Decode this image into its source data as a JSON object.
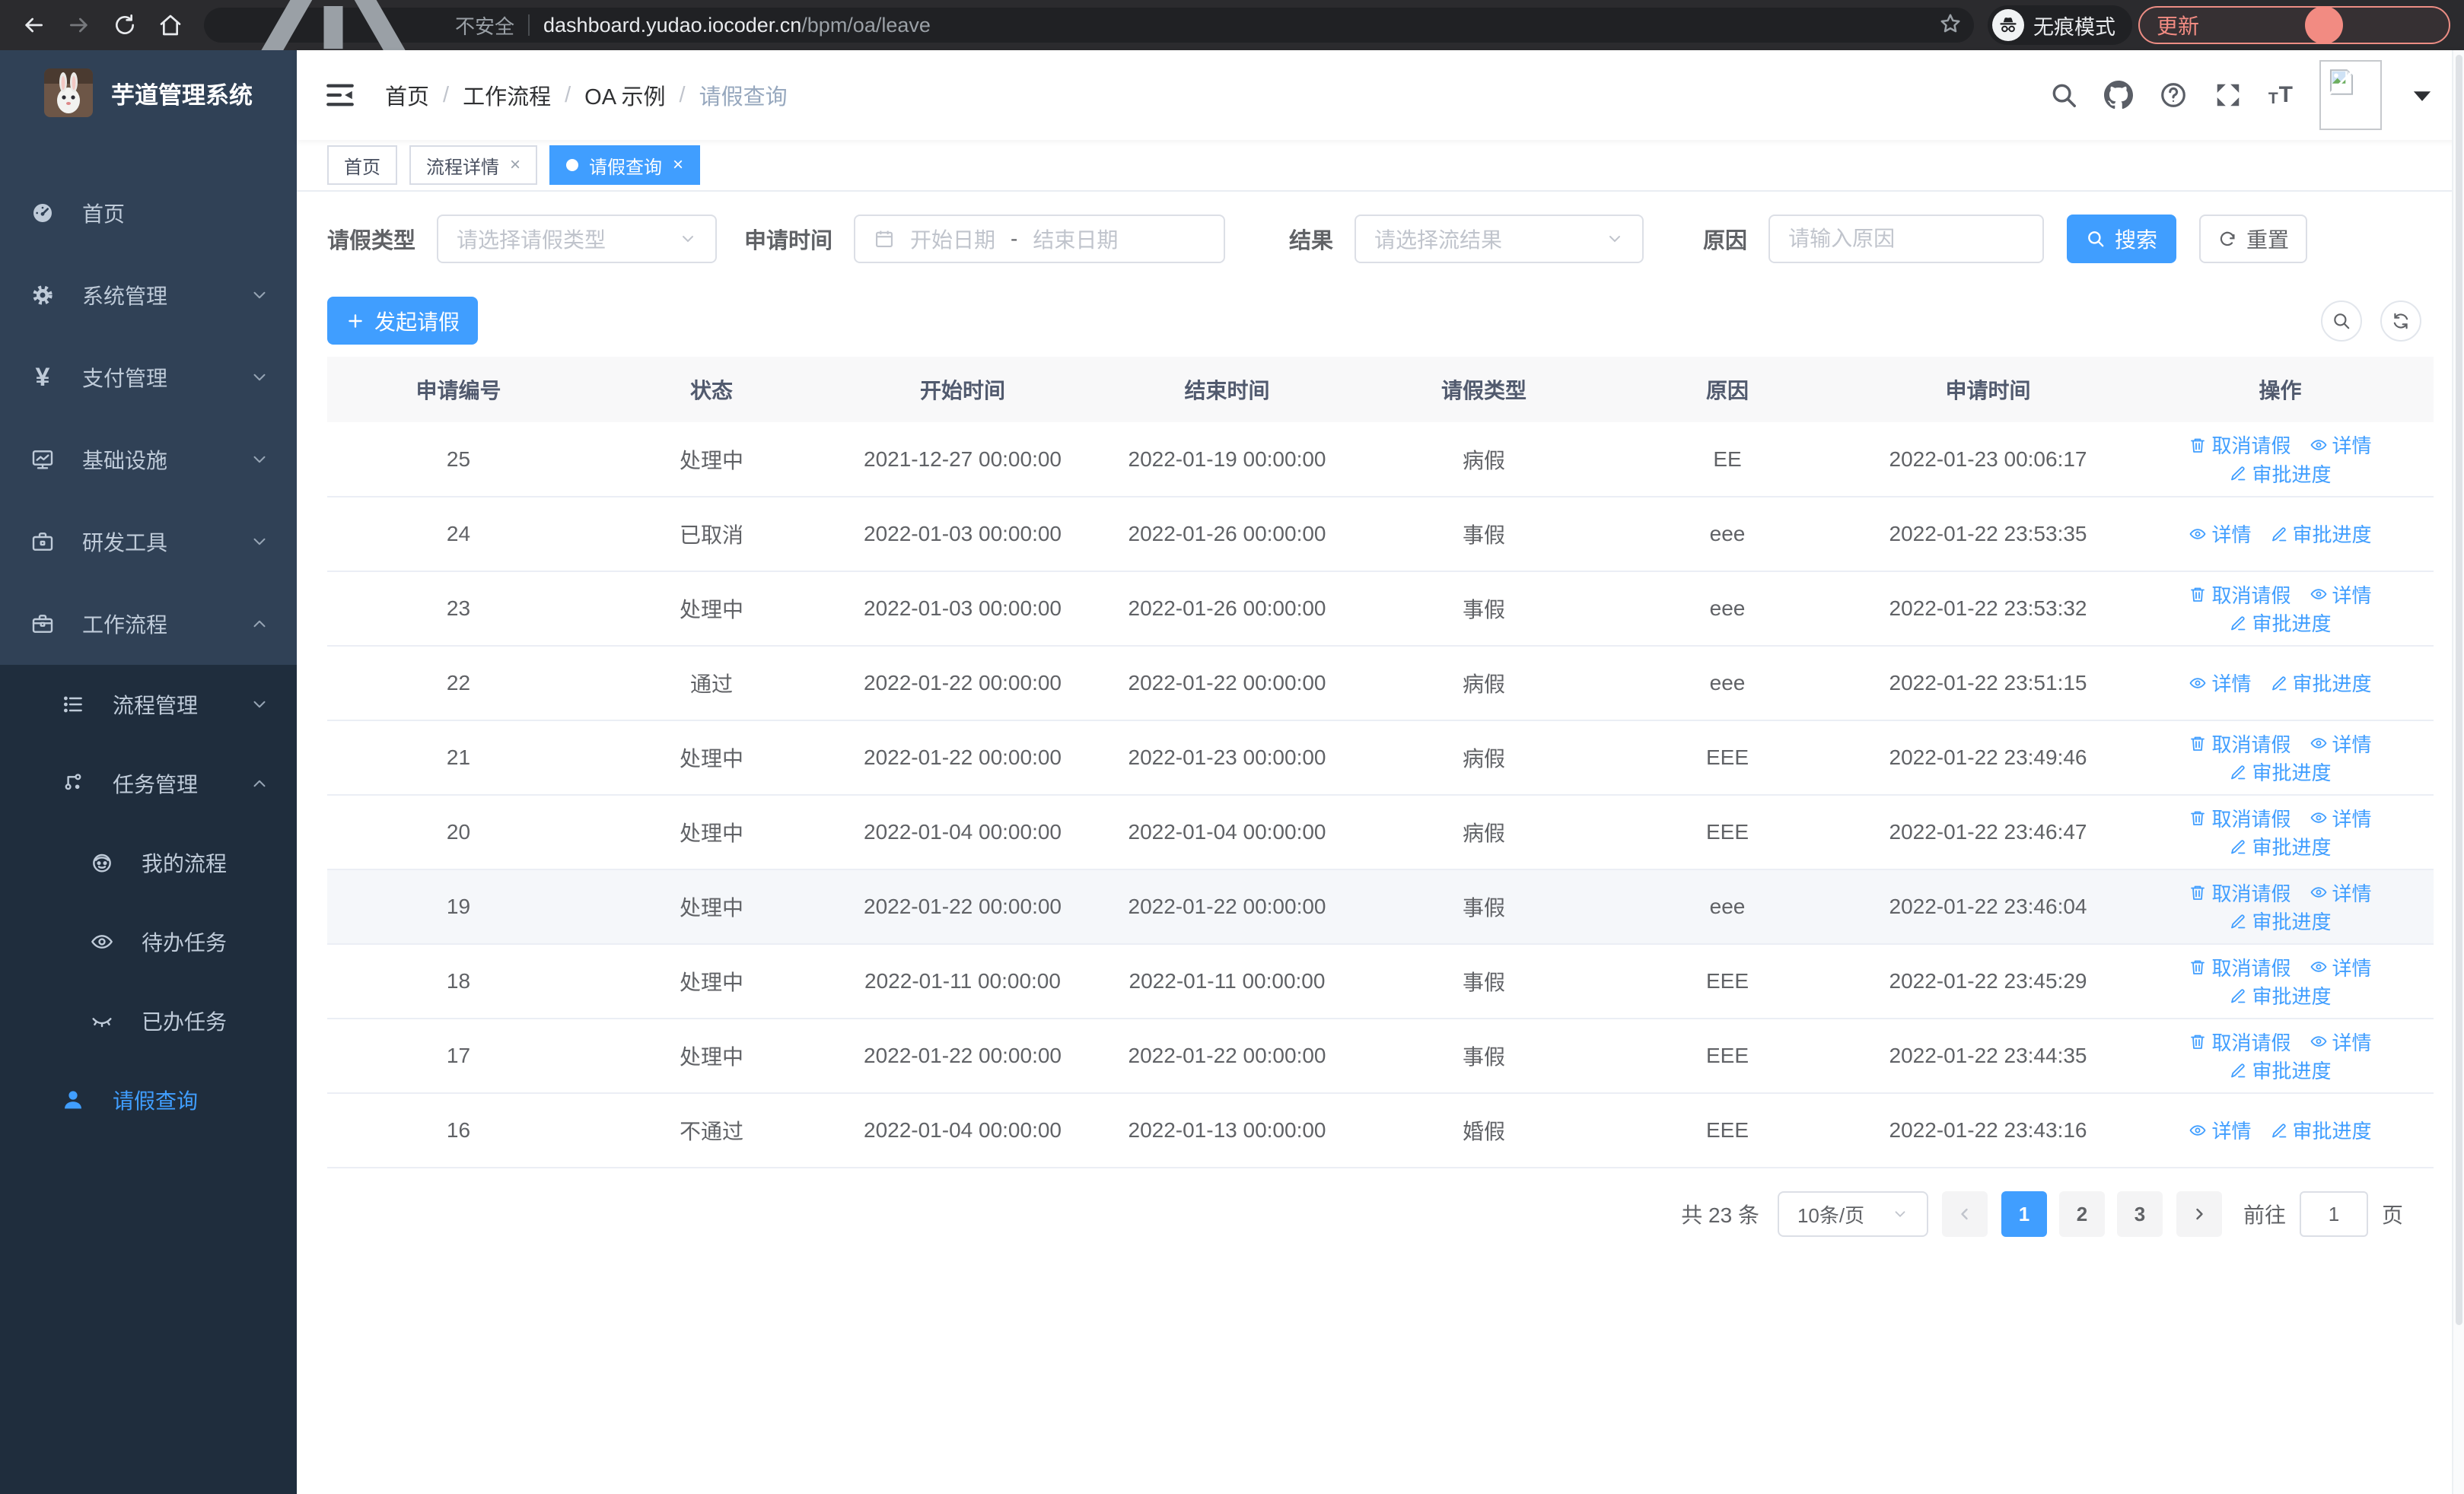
{
  "browser": {
    "security_label": "不安全",
    "url_host": "dashboard.yudao.iocoder.cn",
    "url_path": "/bpm/oa/leave",
    "incognito_label": "无痕模式",
    "update_label": "更新"
  },
  "app": {
    "title": "芋道管理系统"
  },
  "sidebar": {
    "items": [
      {
        "key": "home",
        "label": "首页",
        "icon": "dashboard-icon",
        "level": 1,
        "submenu": false,
        "active": false,
        "chevron": null
      },
      {
        "key": "system-mgmt",
        "label": "系统管理",
        "icon": "gear-icon",
        "level": 1,
        "submenu": false,
        "active": false,
        "chevron": "down"
      },
      {
        "key": "payment-mgmt",
        "label": "支付管理",
        "icon": "yen-icon",
        "level": 1,
        "submenu": false,
        "active": false,
        "chevron": "down"
      },
      {
        "key": "infrastructure",
        "label": "基础设施",
        "icon": "monitor-icon",
        "level": 1,
        "submenu": false,
        "active": false,
        "chevron": "down"
      },
      {
        "key": "dev-tools",
        "label": "研发工具",
        "icon": "toolbox-icon",
        "level": 1,
        "submenu": false,
        "active": false,
        "chevron": "down"
      },
      {
        "key": "workflow",
        "label": "工作流程",
        "icon": "briefcase-icon",
        "level": 1,
        "submenu": false,
        "active": false,
        "chevron": "up"
      },
      {
        "key": "process-mgmt",
        "label": "流程管理",
        "icon": "list-icon",
        "level": 2,
        "submenu": true,
        "active": false,
        "chevron": "down"
      },
      {
        "key": "task-mgmt",
        "label": "任务管理",
        "icon": "flow-icon",
        "level": 2,
        "submenu": true,
        "active": false,
        "chevron": "up"
      },
      {
        "key": "my-process",
        "label": "我的流程",
        "icon": "robot-icon",
        "level": 3,
        "submenu": true,
        "active": false,
        "chevron": null
      },
      {
        "key": "todo-tasks",
        "label": "待办任务",
        "icon": "eye-open-icon",
        "level": 3,
        "submenu": true,
        "active": false,
        "chevron": null
      },
      {
        "key": "done-tasks",
        "label": "已办任务",
        "icon": "eye-closed-icon",
        "level": 3,
        "submenu": true,
        "active": false,
        "chevron": null
      },
      {
        "key": "leave-query",
        "label": "请假查询",
        "icon": "user-icon",
        "level": 2,
        "submenu": true,
        "active": true,
        "chevron": null
      }
    ]
  },
  "breadcrumb": {
    "items": [
      "首页",
      "工作流程",
      "OA 示例",
      "请假查询"
    ]
  },
  "tabs": [
    {
      "label": "首页",
      "closable": false,
      "active": false
    },
    {
      "label": "流程详情",
      "closable": true,
      "active": false
    },
    {
      "label": "请假查询",
      "closable": true,
      "active": true
    }
  ],
  "filters": {
    "leave_type_label": "请假类型",
    "leave_type_placeholder": "请选择请假类型",
    "apply_time_label": "申请时间",
    "start_date_placeholder": "开始日期",
    "range_separator": "-",
    "end_date_placeholder": "结束日期",
    "result_label": "结果",
    "result_placeholder": "请选择流结果",
    "reason_label": "原因",
    "reason_placeholder": "请输入原因",
    "search_label": "搜索",
    "reset_label": "重置"
  },
  "toolbar": {
    "create_label": "发起请假"
  },
  "table": {
    "columns": [
      "申请编号",
      "状态",
      "开始时间",
      "结束时间",
      "请假类型",
      "原因",
      "申请时间",
      "操作"
    ],
    "action_labels": {
      "cancel": "取消请假",
      "detail": "详情",
      "progress": "审批进度"
    },
    "rows": [
      {
        "id": "25",
        "status": "处理中",
        "start": "2021-12-27 00:00:00",
        "end": "2022-01-19 00:00:00",
        "type": "病假",
        "reason": "EE",
        "applied": "2022-01-23 00:06:17",
        "actions": [
          "cancel",
          "detail",
          "progress"
        ],
        "highlight": false
      },
      {
        "id": "24",
        "status": "已取消",
        "start": "2022-01-03 00:00:00",
        "end": "2022-01-26 00:00:00",
        "type": "事假",
        "reason": "eee",
        "applied": "2022-01-22 23:53:35",
        "actions": [
          "detail",
          "progress"
        ],
        "highlight": false
      },
      {
        "id": "23",
        "status": "处理中",
        "start": "2022-01-03 00:00:00",
        "end": "2022-01-26 00:00:00",
        "type": "事假",
        "reason": "eee",
        "applied": "2022-01-22 23:53:32",
        "actions": [
          "cancel",
          "detail",
          "progress"
        ],
        "highlight": false
      },
      {
        "id": "22",
        "status": "通过",
        "start": "2022-01-22 00:00:00",
        "end": "2022-01-22 00:00:00",
        "type": "病假",
        "reason": "eee",
        "applied": "2022-01-22 23:51:15",
        "actions": [
          "detail",
          "progress"
        ],
        "highlight": false
      },
      {
        "id": "21",
        "status": "处理中",
        "start": "2022-01-22 00:00:00",
        "end": "2022-01-23 00:00:00",
        "type": "病假",
        "reason": "EEE",
        "applied": "2022-01-22 23:49:46",
        "actions": [
          "cancel",
          "detail",
          "progress"
        ],
        "highlight": false
      },
      {
        "id": "20",
        "status": "处理中",
        "start": "2022-01-04 00:00:00",
        "end": "2022-01-04 00:00:00",
        "type": "病假",
        "reason": "EEE",
        "applied": "2022-01-22 23:46:47",
        "actions": [
          "cancel",
          "detail",
          "progress"
        ],
        "highlight": false
      },
      {
        "id": "19",
        "status": "处理中",
        "start": "2022-01-22 00:00:00",
        "end": "2022-01-22 00:00:00",
        "type": "事假",
        "reason": "eee",
        "applied": "2022-01-22 23:46:04",
        "actions": [
          "cancel",
          "detail",
          "progress"
        ],
        "highlight": true
      },
      {
        "id": "18",
        "status": "处理中",
        "start": "2022-01-11 00:00:00",
        "end": "2022-01-11 00:00:00",
        "type": "事假",
        "reason": "EEE",
        "applied": "2022-01-22 23:45:29",
        "actions": [
          "cancel",
          "detail",
          "progress"
        ],
        "highlight": false
      },
      {
        "id": "17",
        "status": "处理中",
        "start": "2022-01-22 00:00:00",
        "end": "2022-01-22 00:00:00",
        "type": "事假",
        "reason": "EEE",
        "applied": "2022-01-22 23:44:35",
        "actions": [
          "cancel",
          "detail",
          "progress"
        ],
        "highlight": false
      },
      {
        "id": "16",
        "status": "不通过",
        "start": "2022-01-04 00:00:00",
        "end": "2022-01-13 00:00:00",
        "type": "婚假",
        "reason": "EEE",
        "applied": "2022-01-22 23:43:16",
        "actions": [
          "detail",
          "progress"
        ],
        "highlight": false
      }
    ]
  },
  "pagination": {
    "total_label": "共 23 条",
    "page_size": "10条/页",
    "pages": [
      "1",
      "2",
      "3"
    ],
    "active_page": "1",
    "goto_label": "前往",
    "goto_value": "1",
    "page_suffix": "页"
  },
  "colors": {
    "primary": "#409eff",
    "sidebar_bg": "#304156",
    "submenu_bg": "#1f2d3d",
    "table_header_bg": "#f8f8f9",
    "update_accent": "#f28b82"
  }
}
